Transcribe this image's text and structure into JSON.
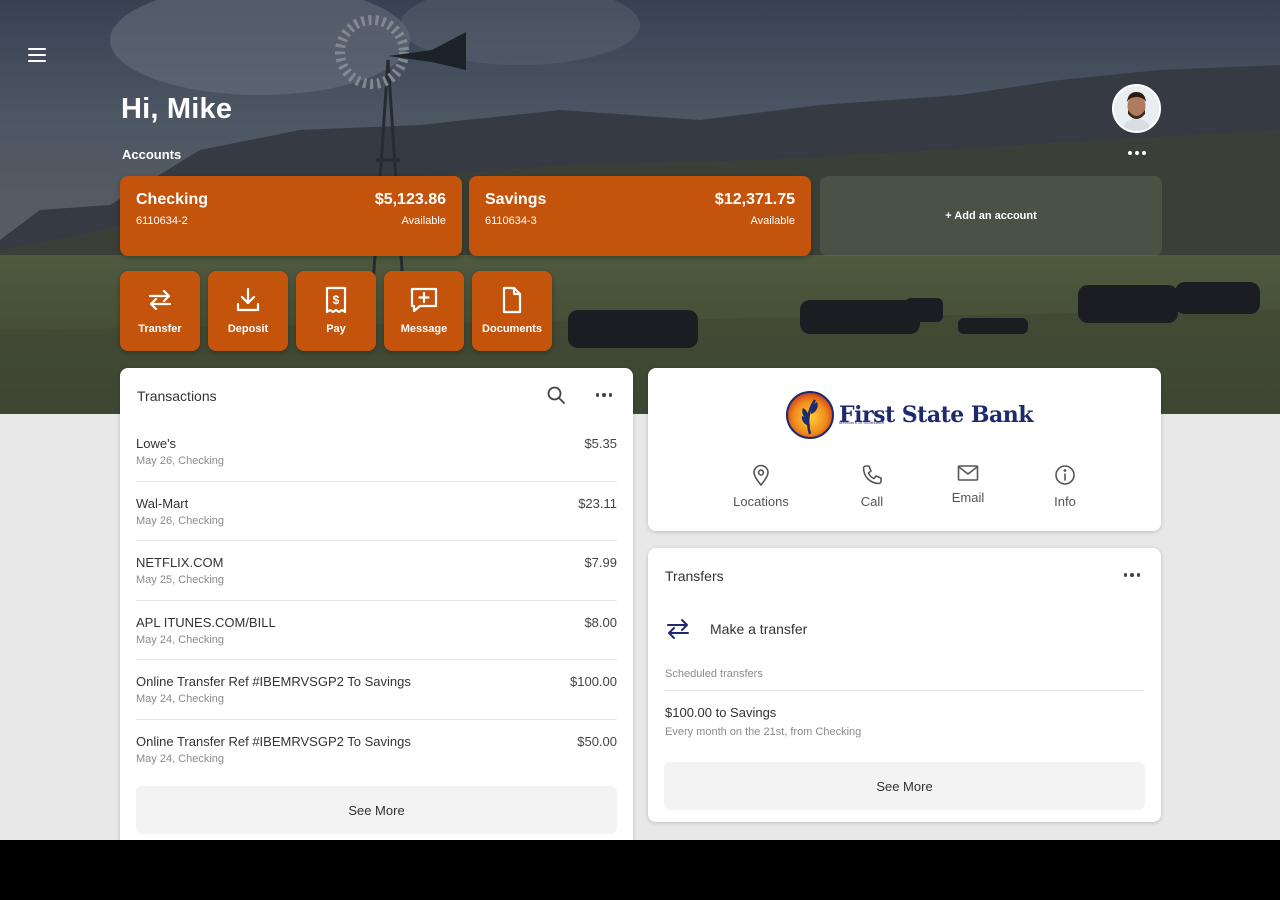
{
  "greeting": "Hi, Mike",
  "accounts_label": "Accounts",
  "accounts": [
    {
      "name": "Checking",
      "number": "6110634-2",
      "balance": "$5,123.86",
      "balance_label": "Available"
    },
    {
      "name": "Savings",
      "number": "6110634-3",
      "balance": "$12,371.75",
      "balance_label": "Available"
    }
  ],
  "add_account_label": "+ Add an account",
  "quick_actions": [
    {
      "label": "Transfer",
      "icon": "transfer-icon"
    },
    {
      "label": "Deposit",
      "icon": "deposit-icon"
    },
    {
      "label": "Pay",
      "icon": "pay-icon"
    },
    {
      "label": "Message",
      "icon": "message-icon"
    },
    {
      "label": "Documents",
      "icon": "documents-icon"
    }
  ],
  "transactions": {
    "title": "Transactions",
    "items": [
      {
        "name": "Lowe's",
        "sub": "May 26, Checking",
        "amount": "$5.35"
      },
      {
        "name": "Wal-Mart",
        "sub": "May 26, Checking",
        "amount": "$23.11"
      },
      {
        "name": "NETFLIX.COM",
        "sub": "May 25, Checking",
        "amount": "$7.99"
      },
      {
        "name": "APL ITUNES.COM/BILL",
        "sub": "May 24, Checking",
        "amount": "$8.00"
      },
      {
        "name": "Online Transfer Ref #IBEMRVSGP2 To Savings",
        "sub": "May 24, Checking",
        "amount": "$100.00"
      },
      {
        "name": "Online Transfer Ref #IBEMRVSGP2 To Savings",
        "sub": "May 24, Checking",
        "amount": "$50.00"
      }
    ],
    "see_more": "See More"
  },
  "bank": {
    "name": "First State Bank",
    "tagline": "Members of Scottsbluff",
    "actions": [
      {
        "label": "Locations",
        "icon": "location-pin-icon"
      },
      {
        "label": "Call",
        "icon": "phone-icon"
      },
      {
        "label": "Email",
        "icon": "email-icon"
      },
      {
        "label": "Info",
        "icon": "info-icon"
      }
    ]
  },
  "transfers": {
    "title": "Transfers",
    "make_transfer": "Make a transfer",
    "scheduled_label": "Scheduled transfers",
    "scheduled": [
      {
        "title": "$100.00 to Savings",
        "sub": "Every month on the 21st, from Checking"
      }
    ],
    "see_more": "See More"
  },
  "colors": {
    "accent": "#c4530c",
    "bank_navy": "#1d2b6e"
  }
}
